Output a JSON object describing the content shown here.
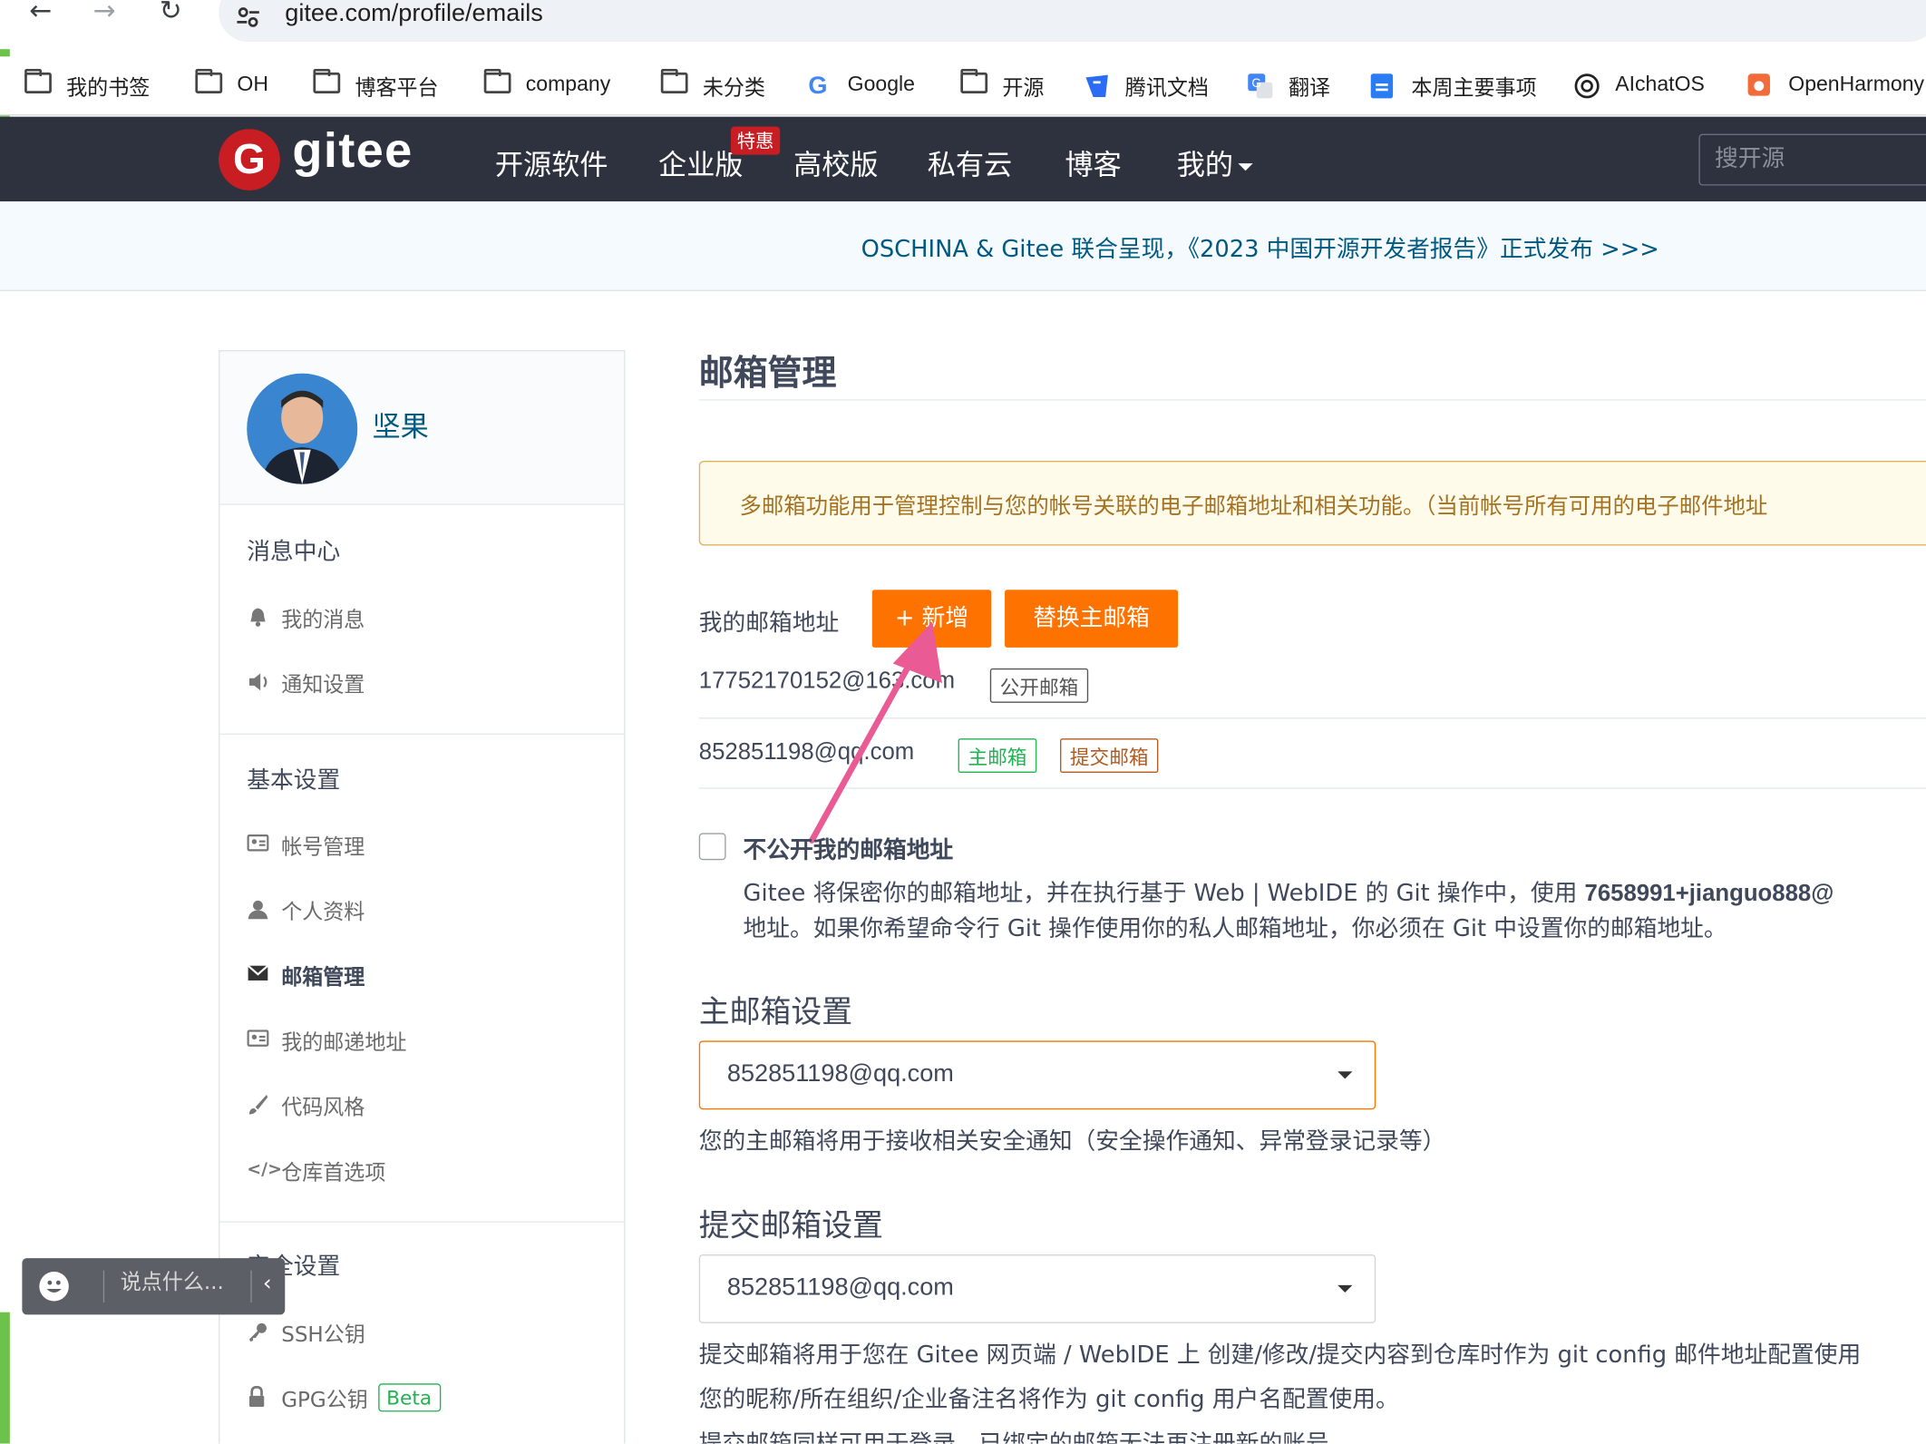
{
  "browser": {
    "url": "gitee.com/profile/emails",
    "bookmarks": [
      "我的书签",
      "OH",
      "博客平台",
      "company",
      "未分类",
      "Google",
      "开源",
      "腾讯文档",
      "翻译",
      "本周主要事项",
      "AIchatOS",
      "OpenHarmony"
    ]
  },
  "header": {
    "brand": "gitee",
    "logo_letter": "G",
    "nav": [
      "开源软件",
      "企业版",
      "高校版",
      "私有云",
      "博客",
      "我的"
    ],
    "promo_badge": "特惠",
    "search_placeholder": "搜开源"
  },
  "announcement": "OSCHINA & Gitee 联合呈现，《2023 中国开源开发者报告》正式发布 >>>",
  "sidebar": {
    "user_name": "坚果",
    "sections": [
      {
        "title": "消息中心",
        "items": [
          "我的消息",
          "通知设置"
        ]
      },
      {
        "title": "基本设置",
        "items": [
          "帐号管理",
          "个人资料",
          "邮箱管理",
          "我的邮递地址",
          "代码风格",
          "仓库首选项"
        ]
      },
      {
        "title": "安全设置",
        "items": [
          "SSH公钥",
          "GPG公钥"
        ]
      }
    ],
    "active_item": "邮箱管理",
    "beta_badge": "Beta"
  },
  "main": {
    "title": "邮箱管理",
    "notice": "多邮箱功能用于管理控制与您的帐号关联的电子邮箱地址和相关功能。（当前帐号所有可用的电子邮件地址",
    "my_emails_label": "我的邮箱地址",
    "add_button": "+ 新增",
    "replace_button": "替换主邮箱",
    "emails": [
      {
        "address": "17752170152@163.com",
        "tags": [
          "公开邮箱"
        ]
      },
      {
        "address": "852851198@qq.com",
        "tags": [
          "主邮箱",
          "提交邮箱"
        ]
      }
    ],
    "hide_email_label": "不公开我的邮箱地址",
    "hide_email_desc_1_prefix": "Gitee 将保密你的邮箱地址，并在执行基于 Web | WebIDE 的 Git 操作中，使用 ",
    "hide_email_desc_1_bold": "7658991+jianguo888@",
    "hide_email_desc_2": "地址。如果你希望命令行 Git 操作使用你的私人邮箱地址，你必须在 Git 中设置你的邮箱地址。",
    "primary_title": "主邮箱设置",
    "primary_selected": "852851198@qq.com",
    "primary_help": "您的主邮箱将用于接收相关安全通知（安全操作通知、异常登录记录等）",
    "commit_title": "提交邮箱设置",
    "commit_selected": "852851198@qq.com",
    "commit_help_1": "提交邮箱将用于您在 Gitee 网页端 / WebIDE 上 创建/修改/提交内容到仓库时作为 git config 邮件地址配置使用",
    "commit_help_2": "您的昵称/所在组织/企业备注名将作为 git config 用户名配置使用。",
    "commit_help_3": "提交邮箱同样可用于登录，已绑定的邮箱无法再注册新的账号。"
  },
  "chat_widget": {
    "placeholder": "说点什么..."
  },
  "colors": {
    "accent_orange": "#fe7300",
    "header_bg": "#2e323e",
    "brand_red": "#c71d23",
    "link_blue": "#005980",
    "arrow_pink": "#ea5a94"
  }
}
